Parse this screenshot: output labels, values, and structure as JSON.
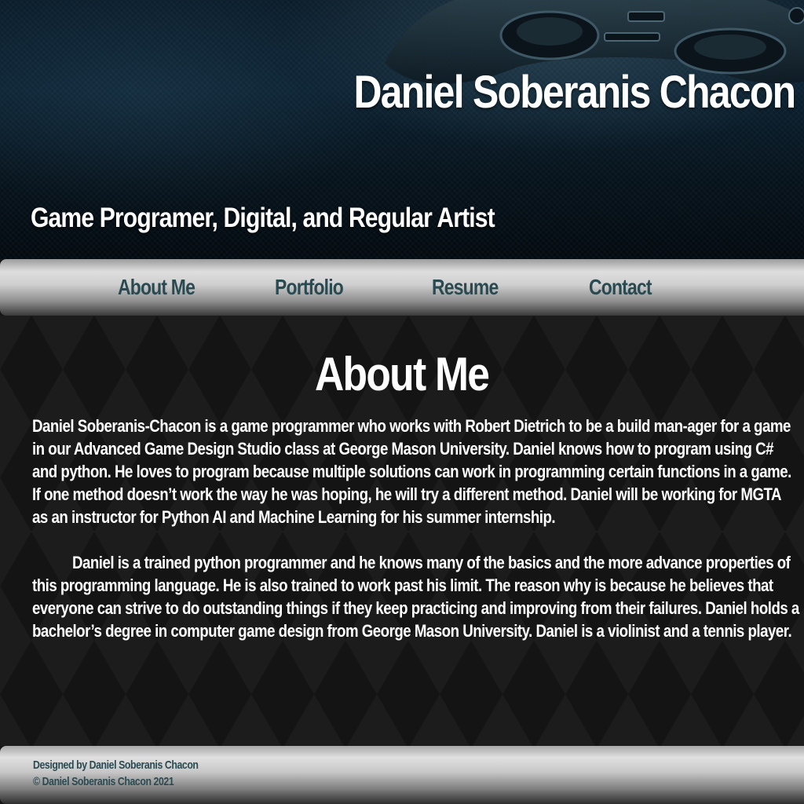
{
  "header": {
    "site_name": "Daniel Soberanis Chacon",
    "tagline": "Game Programer, Digital, and Regular Artist",
    "background_image": "game-controller-photo"
  },
  "nav": {
    "items": [
      {
        "label": "About Me"
      },
      {
        "label": "Portfolio"
      },
      {
        "label": "Resume"
      },
      {
        "label": "Contact"
      }
    ]
  },
  "main": {
    "title": "About Me",
    "paragraphs": [
      "Daniel Soberanis-Chacon is a game programmer who works with Robert Dietrich to be a build man-ager for a game in our Advanced Game Design Studio class at George Mason University. Daniel knows how to program using C# and python. He loves to program because multiple solutions can work in programming certain functions in a game. If one method doesn’t work the way he was hoping, he will try a different method. Daniel will be working for MGTA as an instructor for Python AI and Machine Learning for his summer internship.",
      "Daniel is a trained python programmer and he knows many of the basics and the more advance properties of this programming language. He is also trained to work past his limit. The reason why is because he believes that everyone can strive to do outstanding things if they keep practicing and improving from their failures. Daniel holds a bachelor’s degree in computer game design from George Mason University. Daniel is a violinist and a tennis player."
    ]
  },
  "footer": {
    "designed_by": "Designed by Daniel Soberanis Chacon",
    "copyright": "© Daniel Soberanis Chacon 2021"
  },
  "colors": {
    "nav_text": "#2a4a52",
    "header_bg": "#0b2131",
    "main_bg": "#141414",
    "text": "#ffffff"
  }
}
